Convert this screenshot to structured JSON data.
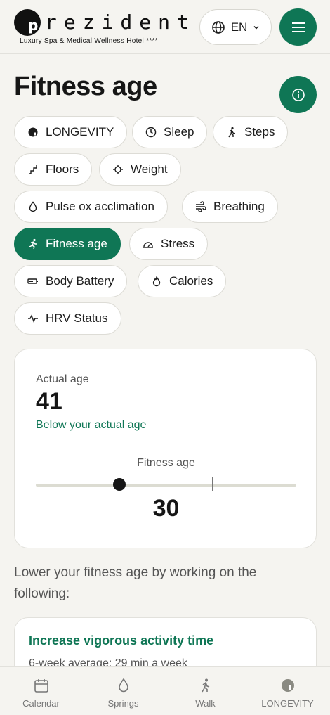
{
  "header": {
    "logo_word": "rezident",
    "logo_letter": "p",
    "logo_tagline": "Luxury Spa & Medical Wellness Hotel ****",
    "language": "EN"
  },
  "page": {
    "title": "Fitness age"
  },
  "chips": [
    {
      "label": "LONGEVITY",
      "icon": "longevity-icon"
    },
    {
      "label": "Sleep",
      "icon": "clock-icon"
    },
    {
      "label": "Steps",
      "icon": "walking-icon"
    },
    {
      "label": "Floors",
      "icon": "stairs-icon"
    },
    {
      "label": "Weight",
      "icon": "crosshair-icon"
    },
    {
      "label": "Pulse ox acclimation",
      "icon": "drop-icon"
    },
    {
      "label": "Breathing",
      "icon": "wind-icon"
    },
    {
      "label": "Fitness age",
      "icon": "running-icon",
      "active": true
    },
    {
      "label": "Stress",
      "icon": "gauge-icon"
    },
    {
      "label": "Body Battery",
      "icon": "battery-icon"
    },
    {
      "label": "Calories",
      "icon": "flame-icon"
    },
    {
      "label": "HRV Status",
      "icon": "pulse-icon"
    }
  ],
  "age_card": {
    "actual_label": "Actual age",
    "actual_value": "41",
    "comparison": "Below your actual age",
    "fitness_label": "Fitness age",
    "fitness_value": "30",
    "fitness_fraction": 0.32,
    "actual_fraction": 0.68
  },
  "advice": {
    "intro": "Lower your fitness age by working on the following:",
    "tip_title": "Increase vigorous activity time",
    "tip_detail": "6-week average: 29 min a week"
  },
  "bottom_nav": [
    {
      "label": "Calendar",
      "icon": "calendar-icon"
    },
    {
      "label": "Springs",
      "icon": "drop-icon"
    },
    {
      "label": "Walk",
      "icon": "walking-icon"
    },
    {
      "label": "LONGEVITY",
      "icon": "longevity-icon"
    }
  ],
  "colors": {
    "accent": "#0f7655",
    "background": "#f5f4f0"
  }
}
